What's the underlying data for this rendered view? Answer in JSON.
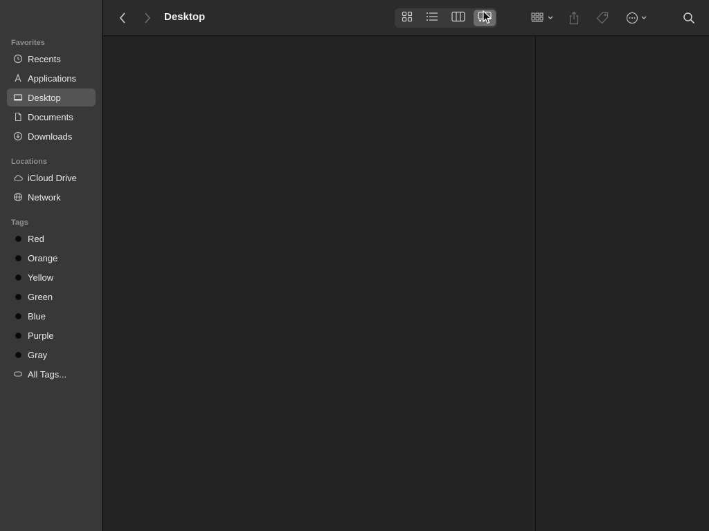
{
  "window": {
    "title": "Desktop"
  },
  "sidebar": {
    "favorites_header": "Favorites",
    "favorites": [
      {
        "label": "Recents",
        "icon": "clock-icon"
      },
      {
        "label": "Applications",
        "icon": "applications-icon"
      },
      {
        "label": "Desktop",
        "icon": "desktop-icon",
        "selected": true
      },
      {
        "label": "Documents",
        "icon": "document-icon"
      },
      {
        "label": "Downloads",
        "icon": "download-icon"
      }
    ],
    "locations_header": "Locations",
    "locations": [
      {
        "label": "iCloud Drive",
        "icon": "cloud-icon"
      },
      {
        "label": "Network",
        "icon": "globe-icon"
      }
    ],
    "tags_header": "Tags",
    "tags": [
      {
        "label": "Red"
      },
      {
        "label": "Orange"
      },
      {
        "label": "Yellow"
      },
      {
        "label": "Green"
      },
      {
        "label": "Blue"
      },
      {
        "label": "Purple"
      },
      {
        "label": "Gray"
      },
      {
        "label": "All Tags...",
        "icon": "all-tags-icon"
      }
    ]
  },
  "toolbar": {
    "back_icon": "chevron-left-icon",
    "forward_icon": "chevron-right-icon",
    "view_modes": [
      "icon-view",
      "list-view",
      "column-view",
      "gallery-view"
    ],
    "active_view": "gallery-view",
    "group_icon": "group-grid-icon",
    "share_icon": "share-icon",
    "tag_icon": "tag-icon",
    "more_icon": "ellipsis-circle-icon",
    "search_icon": "search-icon"
  }
}
